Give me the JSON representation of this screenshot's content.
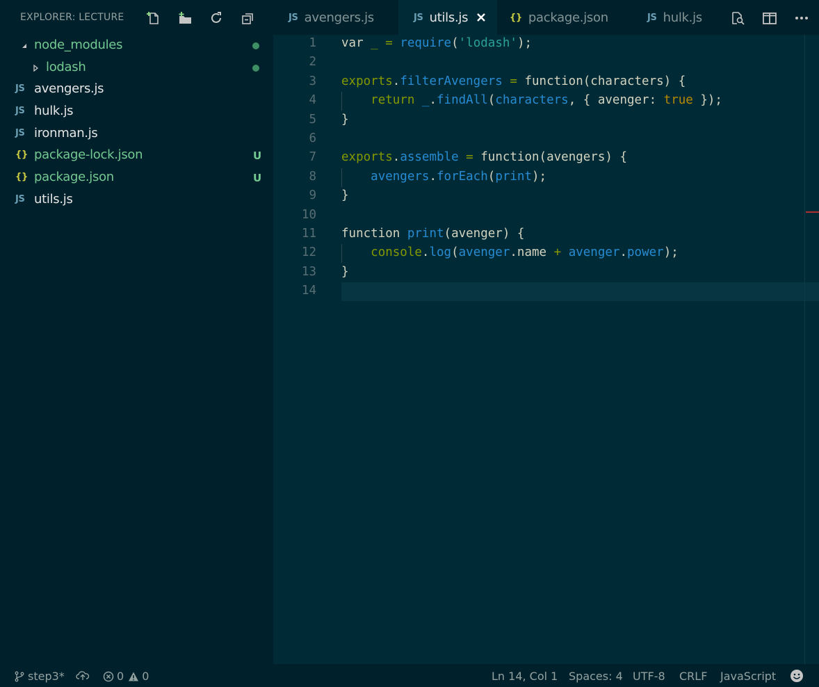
{
  "explorer": {
    "title": "EXPLORER: LECTURE",
    "actions": [
      "new-file",
      "new-folder",
      "refresh",
      "collapse-all"
    ],
    "items": [
      {
        "label": "node_modules",
        "kind": "folder-open",
        "status": "dot"
      },
      {
        "label": "lodash",
        "kind": "folder-closed",
        "status": "dot"
      },
      {
        "label": "avengers.js",
        "kind": "js",
        "status": ""
      },
      {
        "label": "hulk.js",
        "kind": "js",
        "status": ""
      },
      {
        "label": "ironman.js",
        "kind": "js",
        "status": ""
      },
      {
        "label": "package-lock.json",
        "kind": "json",
        "status": "U"
      },
      {
        "label": "package.json",
        "kind": "json",
        "status": "U"
      },
      {
        "label": "utils.js",
        "kind": "js",
        "status": ""
      }
    ]
  },
  "tabs": [
    {
      "label": "avengers.js",
      "icon": "JS",
      "active": false
    },
    {
      "label": "utils.js",
      "icon": "JS",
      "active": true
    },
    {
      "label": "package.json",
      "icon": "{}",
      "active": false
    },
    {
      "label": "hulk.js",
      "icon": "JS",
      "active": false
    }
  ],
  "icons": {
    "js": "JS",
    "json": "{}"
  },
  "editor": {
    "line_numbers": [
      "1",
      "2",
      "3",
      "4",
      "5",
      "6",
      "7",
      "8",
      "9",
      "10",
      "11",
      "12",
      "13",
      "14"
    ]
  },
  "status": {
    "branch": "step3*",
    "errors": "0",
    "warnings": "0",
    "position": "Ln 14, Col 1",
    "spaces": "Spaces: 4",
    "encoding": "UTF-8",
    "eol": "CRLF",
    "language": "JavaScript"
  },
  "colors": {
    "background": "#002b36",
    "sidebar": "#00212b",
    "git_untracked": "#73c991"
  }
}
